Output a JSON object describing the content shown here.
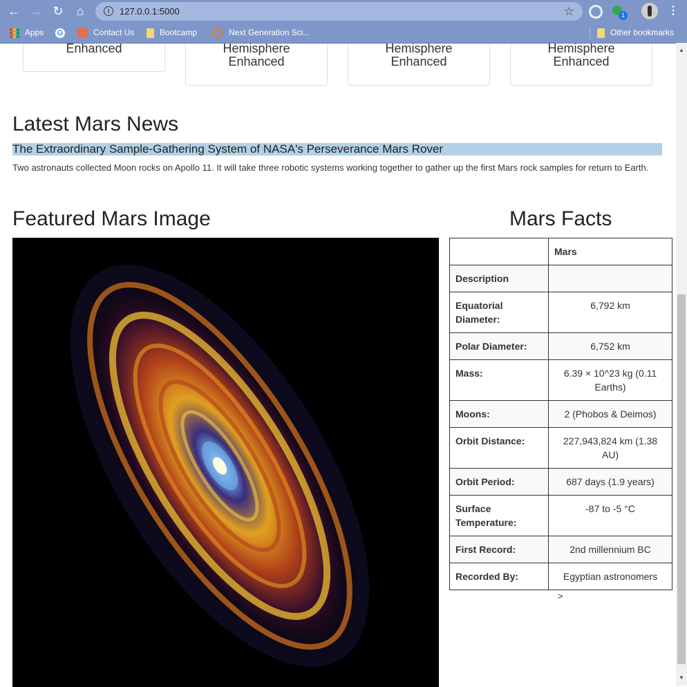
{
  "browser": {
    "url": "127.0.0.1:5000",
    "extension_badge": "1",
    "bookmarks": [
      {
        "label": "Apps",
        "icon": "apps-grid-icon"
      },
      {
        "label": "",
        "icon": "google-icon"
      },
      {
        "label": "Contact Us",
        "icon": "site-icon"
      },
      {
        "label": "Bootcamp",
        "icon": "folder-icon"
      },
      {
        "label": "Next Generation Sci...",
        "icon": "diamond-icon"
      }
    ],
    "other_bookmarks": "Other bookmarks",
    "chrome_color": "#7e97c8"
  },
  "hemispheres": [
    {
      "title": "Enhanced"
    },
    {
      "title": "Hemisphere Enhanced"
    },
    {
      "title": "Hemisphere Enhanced"
    },
    {
      "title": "Hemisphere Enhanced"
    }
  ],
  "news": {
    "heading": "Latest Mars News",
    "title": "The Extraordinary Sample-Gathering System of NASA's Perseverance Mars Rover",
    "paragraph": "Two astronauts collected Moon rocks on Apollo 11. It will take three robotic systems working together to gather up the first Mars rock samples for return to Earth."
  },
  "featured": {
    "heading": "Featured Mars Image"
  },
  "facts": {
    "heading": "Mars Facts",
    "header_col": "Mars",
    "rows": [
      {
        "key": "Description",
        "value": ""
      },
      {
        "key": "Equatorial Diameter:",
        "value": "6,792 km"
      },
      {
        "key": "Polar Diameter:",
        "value": "6,752 km"
      },
      {
        "key": "Mass:",
        "value": "6.39 × 10^23 kg (0.11 Earths)"
      },
      {
        "key": "Moons:",
        "value": "2 (Phobos & Deimos)"
      },
      {
        "key": "Orbit Distance:",
        "value": "227,943,824 km (1.38 AU)"
      },
      {
        "key": "Orbit Period:",
        "value": "687 days (1.9 years)"
      },
      {
        "key": "Surface Temperature:",
        "value": "-87 to -5 °C"
      },
      {
        "key": "First Record:",
        "value": "2nd millennium BC"
      },
      {
        "key": "Recorded By:",
        "value": "Egyptian astronomers"
      }
    ],
    "trailing_text": ">"
  }
}
